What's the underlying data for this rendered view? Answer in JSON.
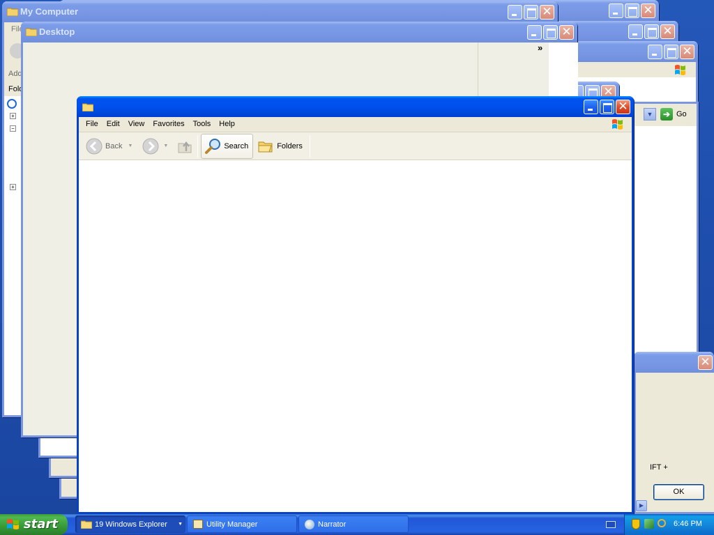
{
  "windows": {
    "my_computer": {
      "title": "My Computer",
      "menu_fragment": "File",
      "addr_fragment": "Add",
      "folders_fragment": "Fold"
    },
    "desktop": {
      "title": "Desktop",
      "chevron": "»"
    },
    "front": {
      "title": "",
      "menu": [
        "File",
        "Edit",
        "View",
        "Favorites",
        "Tools",
        "Help"
      ],
      "toolbar": {
        "back": "Back",
        "search": "Search",
        "folders": "Folders"
      }
    },
    "right_partial": {
      "go_label": "Go"
    },
    "bottom_dialog": {
      "fragment": "IFT +",
      "ok_label": "OK"
    }
  },
  "taskbar": {
    "start_label": "start",
    "tasks": [
      {
        "label": "19 Windows Explorer",
        "active": true
      },
      {
        "label": "Utility Manager",
        "active": false
      },
      {
        "label": "Narrator",
        "active": false
      }
    ],
    "clock": "6:46 PM"
  },
  "colors": {
    "desktop_bg": "#1f4fae",
    "titlebar_active": "#0053ee",
    "titlebar_inactive": "#7b9ce8",
    "taskbar": "#2663e0",
    "start_green": "#3c9c3c",
    "close_red": "#e0502c"
  }
}
